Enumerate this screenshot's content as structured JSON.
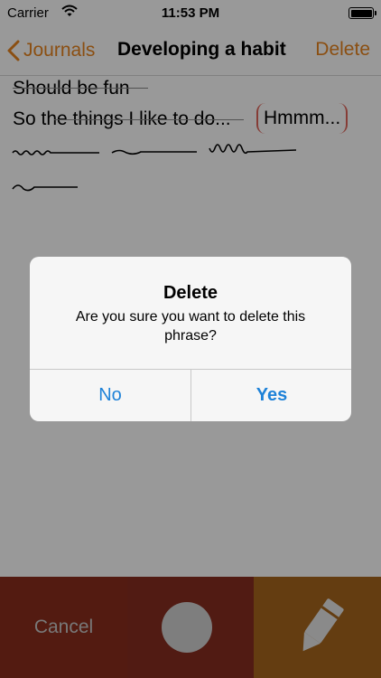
{
  "status_bar": {
    "carrier": "Carrier",
    "time": "11:53 PM"
  },
  "nav": {
    "back_label": "Journals",
    "title": "Developing a habit",
    "action_label": "Delete"
  },
  "journal": {
    "lines": [
      "Should be fun",
      "So the things I like to do..."
    ],
    "selected_phrase": "Hmmm..."
  },
  "alert": {
    "title": "Delete",
    "message": "Are you sure you want to delete this phrase?",
    "no_label": "No",
    "yes_label": "Yes"
  },
  "toolbar": {
    "cancel_label": "Cancel"
  },
  "colors": {
    "accent": "#e8841e",
    "link": "#1e82d8",
    "bracket": "#e0655b",
    "cancel_bg": "#8a2e1d",
    "record_bg": "#882e21",
    "edit_bg": "#a7671d"
  },
  "icons": [
    "wifi-icon",
    "battery-icon",
    "chevron-left-icon",
    "record-circle-icon",
    "pencil-icon"
  ]
}
